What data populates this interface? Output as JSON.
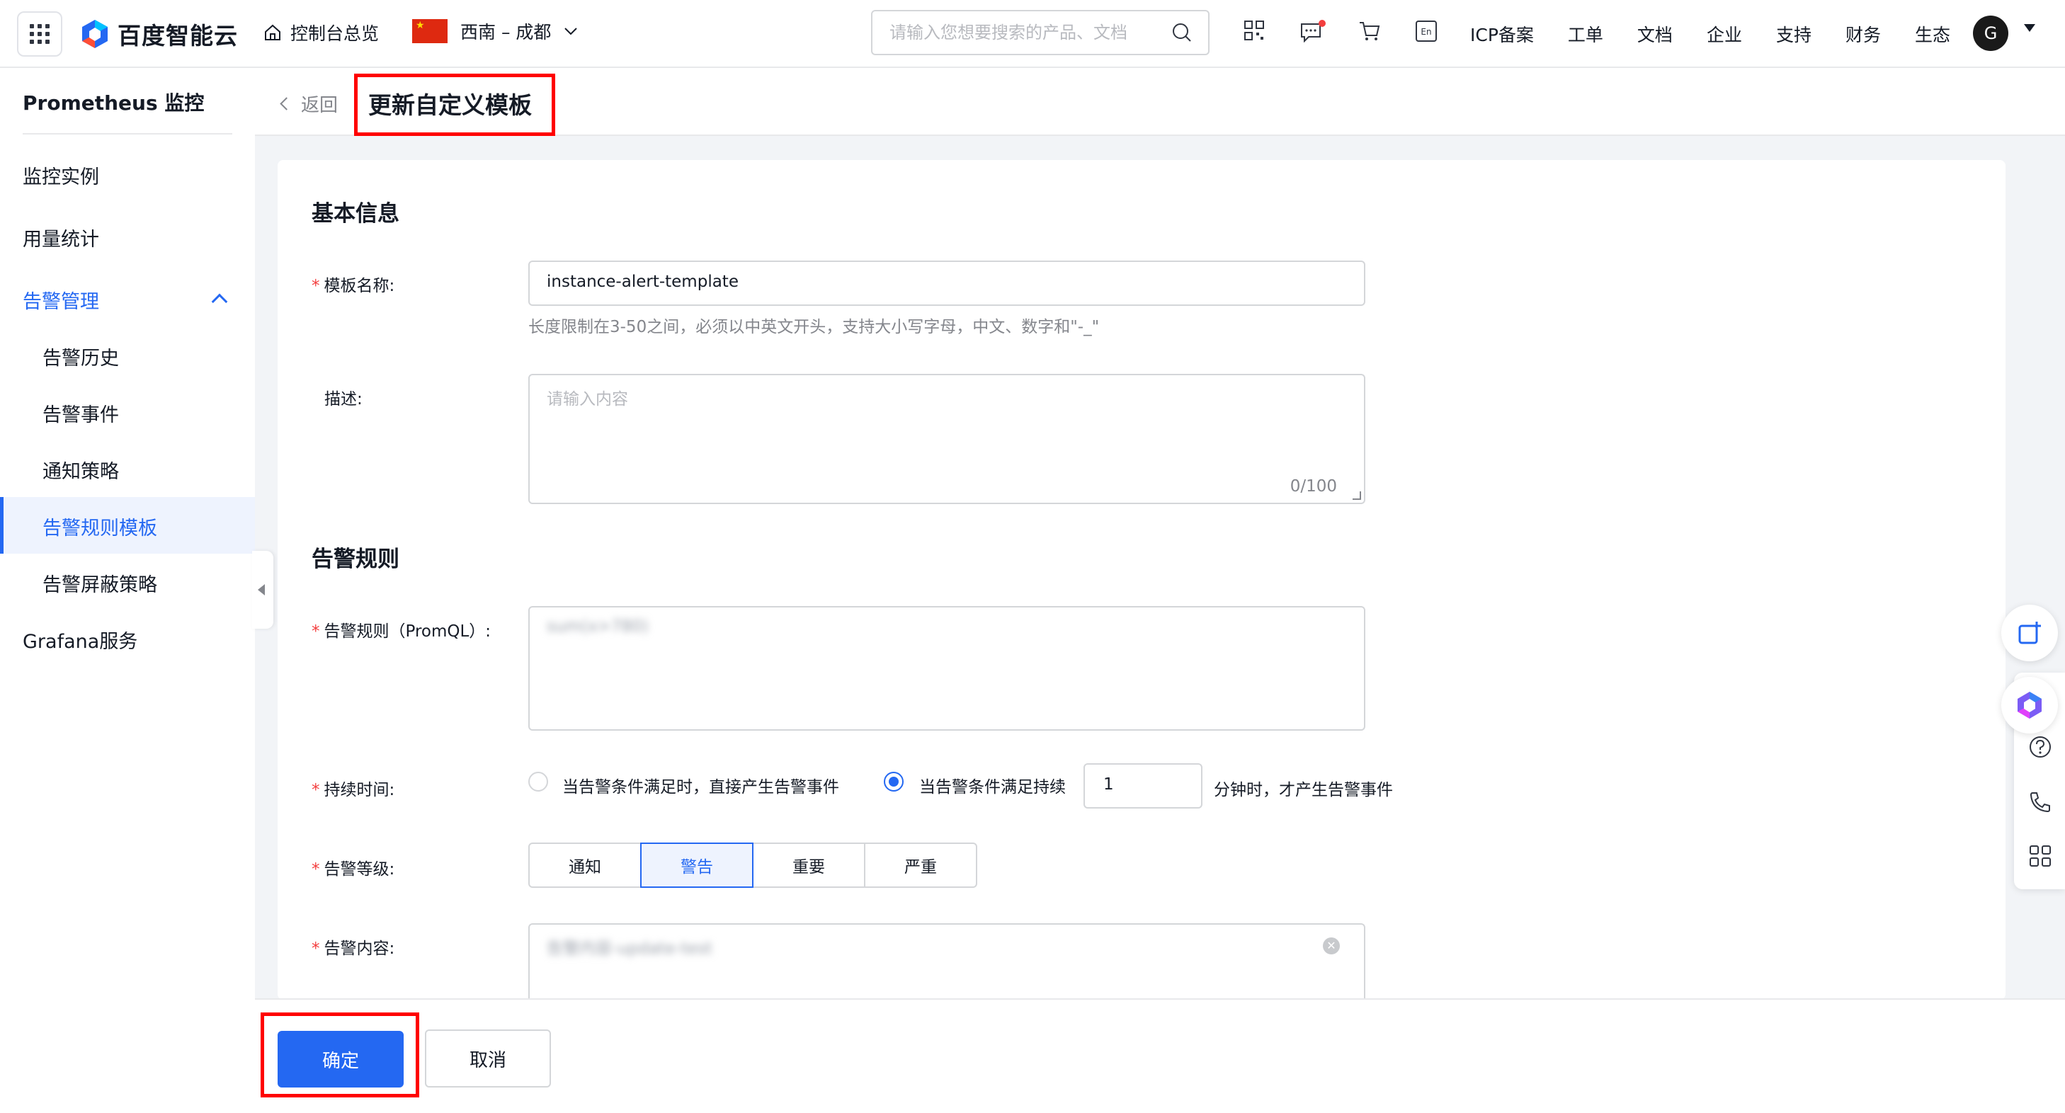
{
  "topbar": {
    "logo_text": "百度智能云",
    "home_label": "控制台总览",
    "region_label": "西南 – 成都",
    "search_placeholder": "请输入您想要搜索的产品、文档",
    "links": [
      "ICP备案",
      "工单",
      "文档",
      "企业",
      "支持",
      "财务",
      "生态"
    ],
    "avatar_letter": "G",
    "lang_badge": "En"
  },
  "sidebar": {
    "title": "Prometheus 监控",
    "items": {
      "instances": "监控实例",
      "usage": "用量统计",
      "alert_mgmt": "告警管理",
      "alert_history": "告警历史",
      "alert_events": "告警事件",
      "notify_policy": "通知策略",
      "rule_templates": "告警规则模板",
      "mute_policy": "告警屏蔽策略",
      "grafana": "Grafana服务"
    }
  },
  "header": {
    "back_label": "返回",
    "title": "更新自定义模板"
  },
  "form": {
    "basic_section": "基本信息",
    "name_label": "模板名称:",
    "name_value": "instance-alert-template",
    "name_hint": "长度限制在3-50之间，必须以中英文开头，支持大小写字母，中文、数字和\"-_\"",
    "desc_label": "描述:",
    "desc_placeholder": "请输入内容",
    "desc_counter": "0/100",
    "rule_section": "告警规则",
    "promql_label": "告警规则（PromQL）:",
    "promql_value": "sum(x>780)",
    "duration_label": "持续时间:",
    "duration_opt1": "当告警条件满足时，直接产生告警事件",
    "duration_opt2": "当告警条件满足持续",
    "duration_value": "1",
    "duration_suffix": "分钟时，才产生告警事件",
    "level_label": "告警等级:",
    "levels": [
      "通知",
      "警告",
      "重要",
      "严重"
    ],
    "selected_level": "警告",
    "content_label": "告警内容:",
    "content_value": "告警内容-update-test"
  },
  "footer": {
    "ok_label": "确定",
    "cancel_label": "取消"
  },
  "colors": {
    "accent": "#2468f2",
    "highlight_box": "#ff0000",
    "required": "#f33e3e"
  }
}
